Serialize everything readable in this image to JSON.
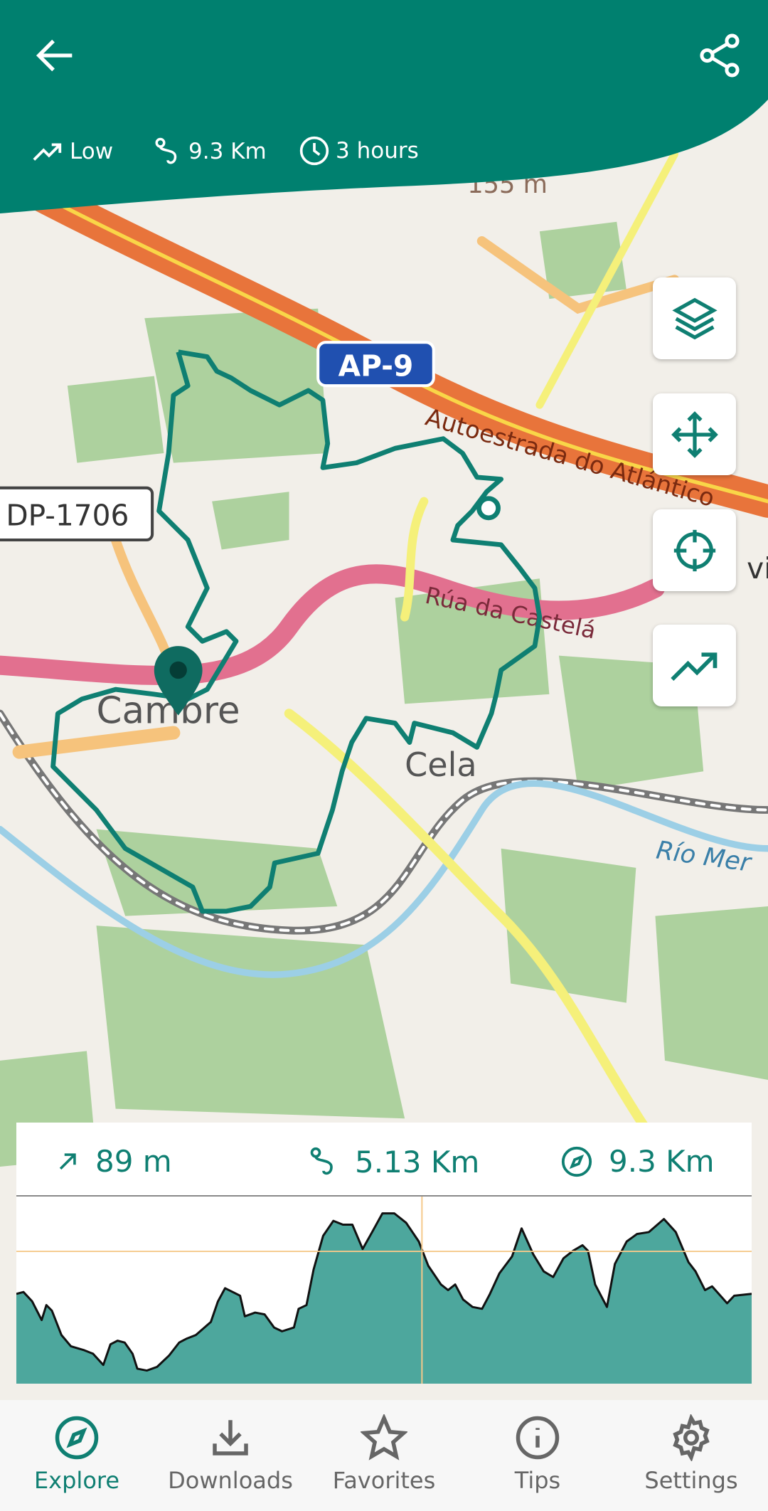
{
  "colors": {
    "primary": "#00806f",
    "route": "#0f7f72",
    "profile_fill": "#4da79d",
    "crosshair": "#f5c98a"
  },
  "header": {
    "back_icon": "arrow-left-icon",
    "share_icon": "share-icon",
    "stats": [
      {
        "icon": "trending-up-icon",
        "label": "Low"
      },
      {
        "icon": "route-icon",
        "label": "9.3 Km"
      },
      {
        "icon": "clock-icon",
        "label": "3 hours"
      }
    ]
  },
  "map": {
    "labels": {
      "motorway": "AP-9",
      "road_ref": "DP-1706",
      "motorway_name": "Autoestrada do Atlántico",
      "street": "Rúa da Castelá",
      "town1": "Cambre",
      "town2": "Cela",
      "river": "Río Mer",
      "partial": "vi",
      "elevation": "155 m"
    },
    "controls": [
      {
        "icon": "layers-icon"
      },
      {
        "icon": "move-icon"
      },
      {
        "icon": "crosshair-icon"
      },
      {
        "icon": "trending-up-icon"
      }
    ]
  },
  "elevation_card": {
    "stats": [
      {
        "icon": "arrow-up-right-icon",
        "label": "89 m"
      },
      {
        "icon": "route-icon",
        "label": "5.13 Km"
      },
      {
        "icon": "compass-icon",
        "label": "9.3 Km"
      }
    ]
  },
  "chart_data": {
    "type": "area",
    "xlabel": "",
    "ylabel": "",
    "xlim": [
      0,
      9.3
    ],
    "ylim": [
      0,
      100
    ],
    "grid": false,
    "x": [
      0,
      0.09,
      0.2,
      0.32,
      0.38,
      0.45,
      0.57,
      0.69,
      0.85,
      0.97,
      1.1,
      1.19,
      1.28,
      1.37,
      1.47,
      1.53,
      1.65,
      1.78,
      1.93,
      2.06,
      2.15,
      2.27,
      2.46,
      2.55,
      2.64,
      2.83,
      2.89,
      3.02,
      3.14,
      3.26,
      3.36,
      3.51,
      3.57,
      3.67,
      3.76,
      3.88,
      4.01,
      4.13,
      4.25,
      4.38,
      4.5,
      4.63,
      4.78,
      4.93,
      5.09,
      5.21,
      5.37,
      5.46,
      5.55,
      5.65,
      5.77,
      5.89,
      5.99,
      6.11,
      6.27,
      6.39,
      6.54,
      6.67,
      6.79,
      6.92,
      7.04,
      7.16,
      7.23,
      7.32,
      7.47,
      7.57,
      7.72,
      7.85,
      8.0,
      8.19,
      8.34,
      8.5,
      8.59,
      8.71,
      8.8,
      8.99,
      9.08,
      9.3
    ],
    "y": [
      48,
      49,
      44,
      34,
      42,
      39,
      26,
      20,
      18,
      16,
      10,
      21,
      23,
      22,
      16,
      8,
      7,
      9,
      15,
      22,
      24,
      26,
      33,
      44,
      51,
      47,
      36,
      38,
      37,
      30,
      28,
      30,
      40,
      42,
      61,
      79,
      87,
      85,
      85,
      72,
      81,
      91,
      91,
      86,
      76,
      63,
      53,
      50,
      53,
      45,
      41,
      40,
      48,
      59,
      68,
      83,
      69,
      60,
      57,
      67,
      71,
      74,
      71,
      53,
      41,
      64,
      76,
      80,
      81,
      88,
      81,
      65,
      60,
      50,
      52,
      43,
      47,
      48
    ],
    "cursor": {
      "x": 5.13,
      "y": 70.7
    }
  },
  "nav": {
    "items": [
      {
        "label": "Explore",
        "icon": "compass-icon",
        "active": true
      },
      {
        "label": "Downloads",
        "icon": "download-icon"
      },
      {
        "label": "Favorites",
        "icon": "star-icon"
      },
      {
        "label": "Tips",
        "icon": "info-icon"
      },
      {
        "label": "Settings",
        "icon": "gear-icon"
      }
    ]
  }
}
